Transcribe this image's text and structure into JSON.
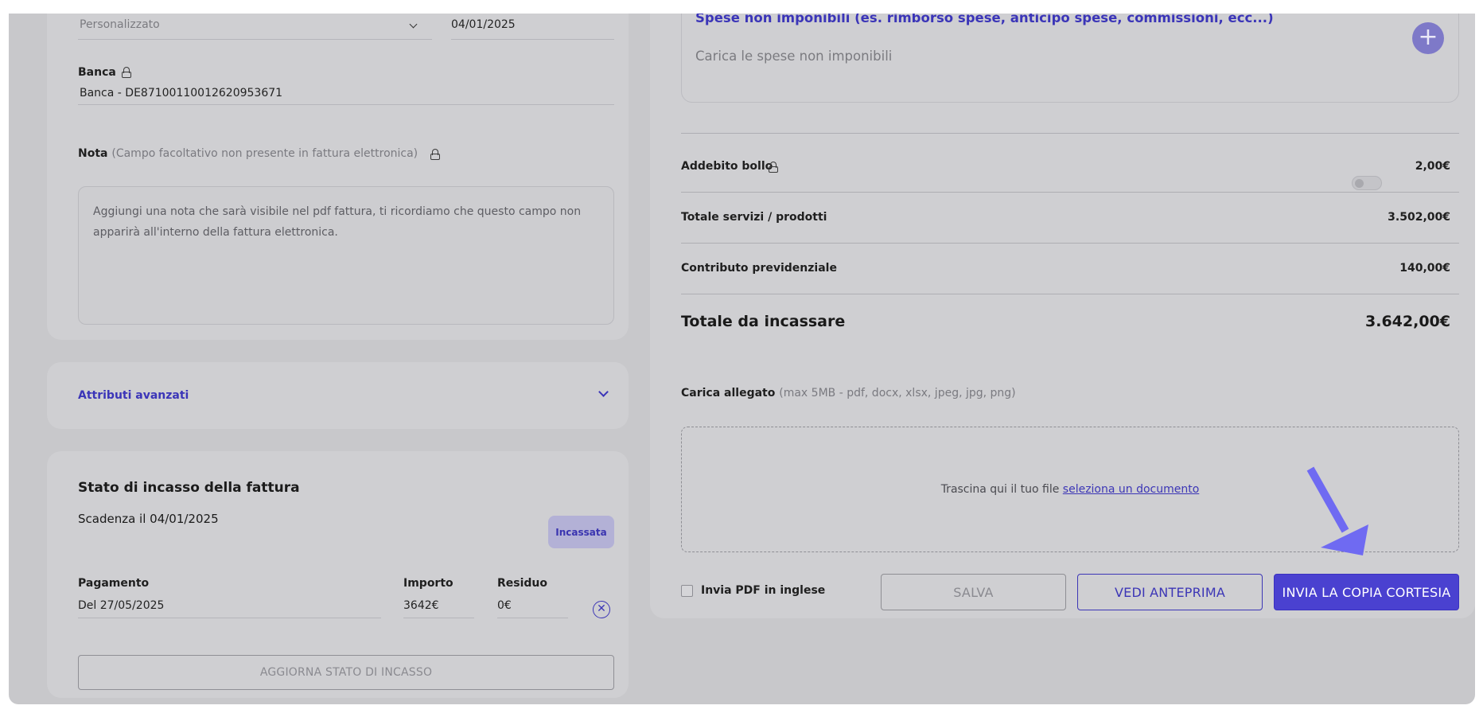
{
  "left": {
    "select_value": "Personalizzato",
    "date_value": "04/01/2025",
    "banca_label": "Banca",
    "banca_value": "Banca - DE87100110012620953671",
    "nota_label": "Nota",
    "nota_hint": "(Campo facoltativo non presente in fattura elettronica)",
    "nota_placeholder": "Aggiungi una nota che sarà visibile nel pdf fattura, ti ricordiamo che questo campo non apparirà all'interno della fattura elettronica.",
    "advanced_label": "Attributi avanzati"
  },
  "stato": {
    "title": "Stato di incasso della fattura",
    "scadenza": "Scadenza il 04/01/2025",
    "badge": "Incassata",
    "col_pagamento": "Pagamento",
    "col_importo": "Importo",
    "col_residuo": "Residuo",
    "row_pagamento": "Del 27/05/2025",
    "row_importo": "3642€",
    "row_residuo": "0€",
    "remove_symbol": "✕",
    "update_button": "AGGIORNA STATO DI INCASSO"
  },
  "right": {
    "spese_title": "Spese non imponibili (es. rimborso spese, anticipo spese, commissioni, ecc...)",
    "spese_placeholder": "Carica le spese non imponibili",
    "add_symbol": "+",
    "bollo_label": "Addebito bollo",
    "bollo_value": "2,00€",
    "servizi_label": "Totale servizi / prodotti",
    "servizi_value": "3.502,00€",
    "contributo_label": "Contributo previdenziale",
    "contributo_value": "140,00€",
    "totale_label": "Totale da incassare",
    "totale_value": "3.642,00€",
    "allegato_label": "Carica allegato",
    "allegato_hint": "(max 5MB - pdf, docx, xlsx, jpeg, jpg, png)",
    "drop_text": "Trascina qui il tuo file",
    "drop_link": "seleziona un documento",
    "inglese_label": "Invia PDF in inglese",
    "salva_button": "SALVA",
    "anteprima_button": "VEDI ANTEPRIMA",
    "invia_button": "INVIA LA COPIA CORTESIA"
  },
  "colors": {
    "accent": "#4a41d0",
    "link": "#3c36b6",
    "overlay": "#c8c8cb",
    "arrow": "#6f6af2"
  },
  "icons": [
    "chevron-down-icon",
    "lock-icon",
    "plus-icon",
    "close-circle-icon",
    "arrow-annotation-icon"
  ]
}
